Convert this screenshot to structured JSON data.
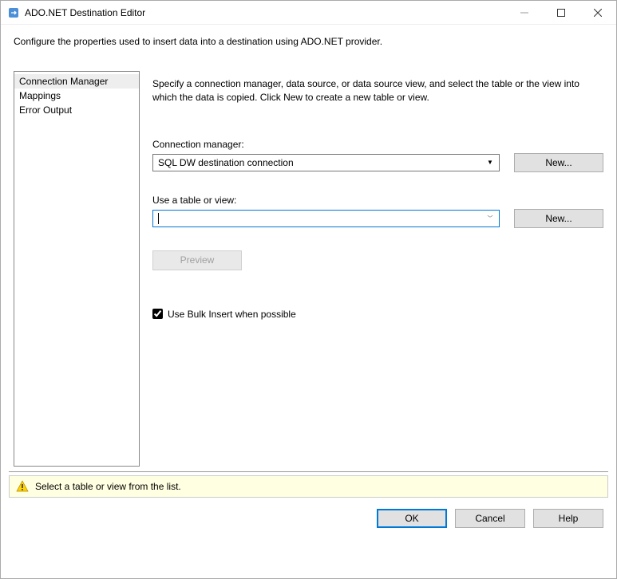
{
  "window": {
    "title": "ADO.NET Destination Editor"
  },
  "description": "Configure the properties used to insert data into a destination using ADO.NET provider.",
  "sidebar": {
    "items": [
      {
        "label": "Connection Manager",
        "selected": true
      },
      {
        "label": "Mappings",
        "selected": false
      },
      {
        "label": "Error Output",
        "selected": false
      }
    ]
  },
  "pane": {
    "instructions": "Specify a connection manager, data source, or data source view, and select the table or the view into which the data is copied. Click New to create a new table or view.",
    "connection_label": "Connection manager:",
    "connection_value": "SQL DW destination connection",
    "connection_new": "New...",
    "table_label": "Use a table or view:",
    "table_value": "",
    "table_new": "New...",
    "preview_label": "Preview",
    "bulk_insert_label": "Use Bulk Insert when possible",
    "bulk_insert_checked": true
  },
  "status": {
    "message": "Select a table or view from the list."
  },
  "footer": {
    "ok": "OK",
    "cancel": "Cancel",
    "help": "Help"
  }
}
